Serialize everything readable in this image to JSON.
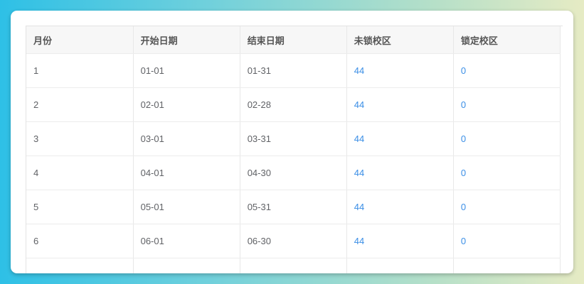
{
  "table": {
    "headers": [
      "月份",
      "开始日期",
      "结束日期",
      "未锁校区",
      "锁定校区"
    ],
    "rows": [
      {
        "month": "1",
        "start": "01-01",
        "end": "01-31",
        "unlocked": "44",
        "locked": "0"
      },
      {
        "month": "2",
        "start": "02-01",
        "end": "02-28",
        "unlocked": "44",
        "locked": "0"
      },
      {
        "month": "3",
        "start": "03-01",
        "end": "03-31",
        "unlocked": "44",
        "locked": "0"
      },
      {
        "month": "4",
        "start": "04-01",
        "end": "04-30",
        "unlocked": "44",
        "locked": "0"
      },
      {
        "month": "5",
        "start": "05-01",
        "end": "05-31",
        "unlocked": "44",
        "locked": "0"
      },
      {
        "month": "6",
        "start": "06-01",
        "end": "06-30",
        "unlocked": "44",
        "locked": "0"
      }
    ]
  },
  "colors": {
    "link": "#3a8ee6",
    "header_bg": "#f7f7f7",
    "text": "#606266"
  }
}
